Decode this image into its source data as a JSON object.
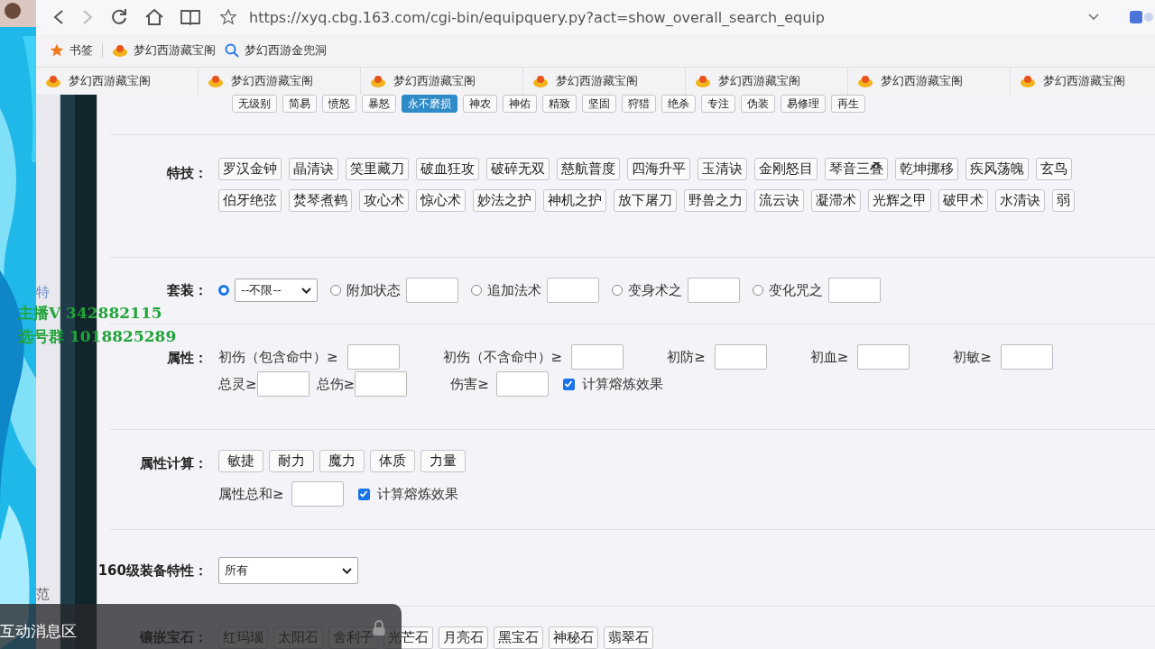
{
  "browser": {
    "url": "https://xyq.cbg.163.com/cgi-bin/equipquery.py?act=show_overall_search_equip",
    "bookmarks": [
      {
        "kind": "star",
        "label": "书签"
      },
      {
        "kind": "ingot",
        "label": "梦幻西游藏宝阁"
      },
      {
        "kind": "search",
        "label": "梦幻西游金兜洞"
      }
    ],
    "tabs": [
      "梦幻西游藏宝阁",
      "梦幻西游藏宝阁",
      "梦幻西游藏宝阁",
      "梦幻西游藏宝阁",
      "梦幻西游藏宝阁",
      "梦幻西游藏宝阁",
      "梦幻西游藏宝阁"
    ]
  },
  "sidebar": {
    "items": [
      "特",
      "范"
    ]
  },
  "top_tags": [
    {
      "label": "无级别",
      "selected": false
    },
    {
      "label": "简易",
      "selected": false
    },
    {
      "label": "愤怒",
      "selected": false
    },
    {
      "label": "暴怒",
      "selected": false
    },
    {
      "label": "永不磨损",
      "selected": true
    },
    {
      "label": "神农",
      "selected": false
    },
    {
      "label": "神佑",
      "selected": false
    },
    {
      "label": "精致",
      "selected": false
    },
    {
      "label": "坚固",
      "selected": false
    },
    {
      "label": "狩猎",
      "selected": false
    },
    {
      "label": "绝杀",
      "selected": false
    },
    {
      "label": "专注",
      "selected": false
    },
    {
      "label": "伪装",
      "selected": false
    },
    {
      "label": "易修理",
      "selected": false
    },
    {
      "label": "再生",
      "selected": false
    }
  ],
  "skills": {
    "label": "特技：",
    "rows": [
      {
        "tags": [
          "罗汉金钟",
          "晶清诀",
          "笑里藏刀",
          "破血狂攻",
          "破碎无双",
          "慈航普度",
          "四海升平",
          "玉清诀",
          "金刚怒目",
          "琴音三叠",
          "乾坤挪移",
          "疾风荡魄",
          "玄鸟"
        ]
      },
      {
        "tags": [
          "伯牙绝弦",
          "焚琴煮鹤",
          "攻心术",
          "惊心术",
          "妙法之护",
          "神机之护",
          "放下屠刀",
          "野兽之力",
          "流云诀",
          "凝滞术",
          "光辉之甲",
          "破甲术",
          "水清诀",
          "弱"
        ]
      }
    ]
  },
  "set": {
    "label": "套装：",
    "options": [
      {
        "kind": "select",
        "value": "--不限--",
        "selected": true
      },
      {
        "kind": "input",
        "label": "附加状态",
        "selected": false
      },
      {
        "kind": "input",
        "label": "追加法术",
        "selected": false
      },
      {
        "kind": "input",
        "label": "变身术之",
        "selected": false
      },
      {
        "kind": "input",
        "label": "变化咒之",
        "selected": false
      }
    ]
  },
  "attributes": {
    "label": "属性：",
    "rows": [
      {
        "fields": [
          "初伤（包含命中）≥",
          "初伤（不含命中）≥",
          "初防≥",
          "初血≥",
          "初敏≥"
        ]
      },
      {
        "fields": [
          "总灵≥",
          "总伤≥",
          "伤害≥"
        ]
      }
    ],
    "checkbox": {
      "label": "计算熔炼效果",
      "checked": true
    }
  },
  "attr_calc": {
    "label": "属性计算：",
    "buttons": [
      "敏捷",
      "耐力",
      "魔力",
      "体质",
      "力量"
    ],
    "sum_label": "属性总和≥",
    "checkbox": {
      "label": "计算熔炼效果",
      "checked": true
    }
  },
  "level160": {
    "label": "160级装备特性：",
    "value": "所有"
  },
  "gems": {
    "label": "镶嵌宝石：",
    "items": [
      "红玛瑙",
      "太阳石",
      "舍利子",
      "光芒石",
      "月亮石",
      "黑宝石",
      "神秘石",
      "翡翠石"
    ]
  },
  "overlay": {
    "lines": [
      "主播V 342882115",
      "选号群 1018825289"
    ]
  },
  "chat": {
    "title": "互动消息区"
  }
}
